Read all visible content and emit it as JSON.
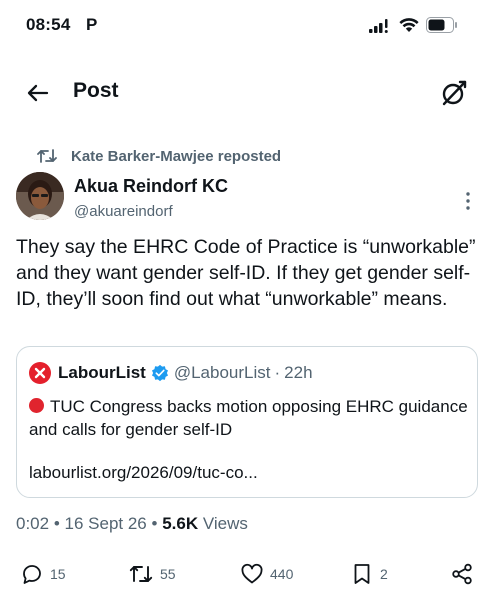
{
  "status_bar": {
    "time": "08:54",
    "carrier_icon": "P"
  },
  "header": {
    "title": "Post"
  },
  "repost": {
    "label": "Kate Barker-Mawjee reposted"
  },
  "author": {
    "name": "Akua Reindorf KC",
    "handle": "@akuareindorf"
  },
  "tweet": {
    "text": "They say the EHRC Code of Practice is “unworkable” and they want gender self-ID. If they get gender self-ID, they’ll soon find out what “unworkable” means."
  },
  "quote": {
    "name": "LabourList",
    "handle": "@LabourList",
    "separator": "·",
    "time": "22h",
    "text": "TUC Congress backs motion opposing EHRC guidance and calls for gender self-ID",
    "link": "labourlist.org/2026/09/tuc-co..."
  },
  "meta": {
    "time": "0:02",
    "sep1": "•",
    "date": "16 Sept 26",
    "sep2": "•",
    "views_count": "5.6K",
    "views_label": "Views"
  },
  "actions": {
    "replies": "15",
    "reposts": "55",
    "likes": "440",
    "bookmarks": "2"
  },
  "colors": {
    "text_primary": "#0f1419",
    "text_secondary": "#536471",
    "border": "#cfd9de",
    "verified_blue": "#1d9bf0",
    "labour_red": "#e4202c"
  }
}
